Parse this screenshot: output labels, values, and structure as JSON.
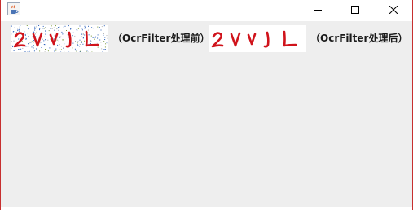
{
  "window": {
    "title": "",
    "icon": "java-cup-icon",
    "controls": [
      "minimize-icon",
      "maximize-icon",
      "close-icon"
    ]
  },
  "images": [
    {
      "label": "（OcrFilter处理前）",
      "captcha_text": "2VVJL",
      "noise": "speckled"
    },
    {
      "label": "（OcrFilter处理后）",
      "captcha_text": "2VVJL",
      "noise": "none"
    }
  ],
  "colors": {
    "captcha_stroke": "#d0131b",
    "noise_dot": "#2a5fb8",
    "window_border": "#c72f2f",
    "client_bg": "#eeeeee"
  }
}
